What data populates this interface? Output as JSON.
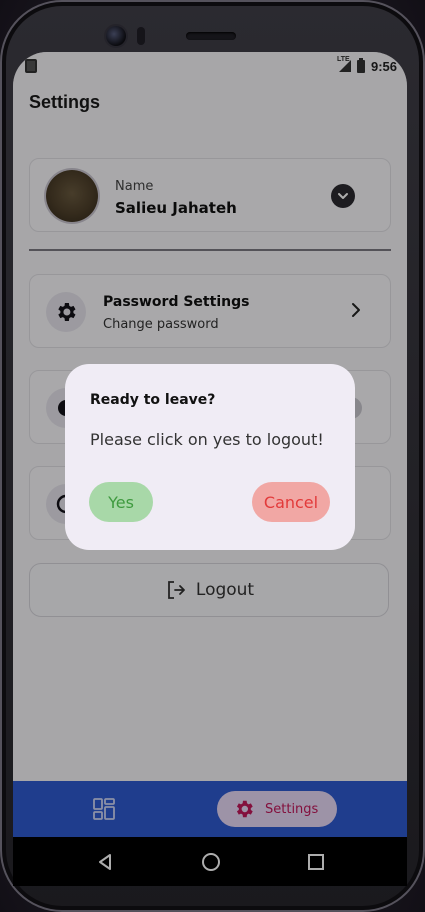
{
  "status_bar": {
    "time": "9:56",
    "network": "LTE"
  },
  "header": {
    "title": "Settings"
  },
  "profile": {
    "name_label": "Name",
    "name_value": "Salieu Jahateh"
  },
  "options": [
    {
      "title": "Password Settings",
      "subtitle": "Change password",
      "icon": "gear-icon"
    },
    {
      "title": "",
      "subtitle": "",
      "icon": "toggle-icon"
    },
    {
      "title": "",
      "subtitle": "",
      "icon": "circle-icon"
    }
  ],
  "logout": {
    "label": "Logout",
    "icon": "logout-icon"
  },
  "bottom_nav": {
    "items": [
      {
        "icon": "dashboard-grid-icon"
      },
      {
        "icon": "gear-icon",
        "label": "Settings",
        "active": true
      }
    ]
  },
  "dialog": {
    "title": "Ready to leave?",
    "body": "Please click on yes to logout!",
    "yes_label": "Yes",
    "cancel_label": "Cancel"
  },
  "colors": {
    "nav_blue": "#2f5bd0",
    "accent_pink": "#c2185b",
    "yes_bg": "#a8d8a8",
    "yes_text": "#3f9a3f",
    "cancel_bg": "#f1a7a4",
    "cancel_text": "#e23a3a",
    "dialog_bg": "#f0ecf5"
  }
}
